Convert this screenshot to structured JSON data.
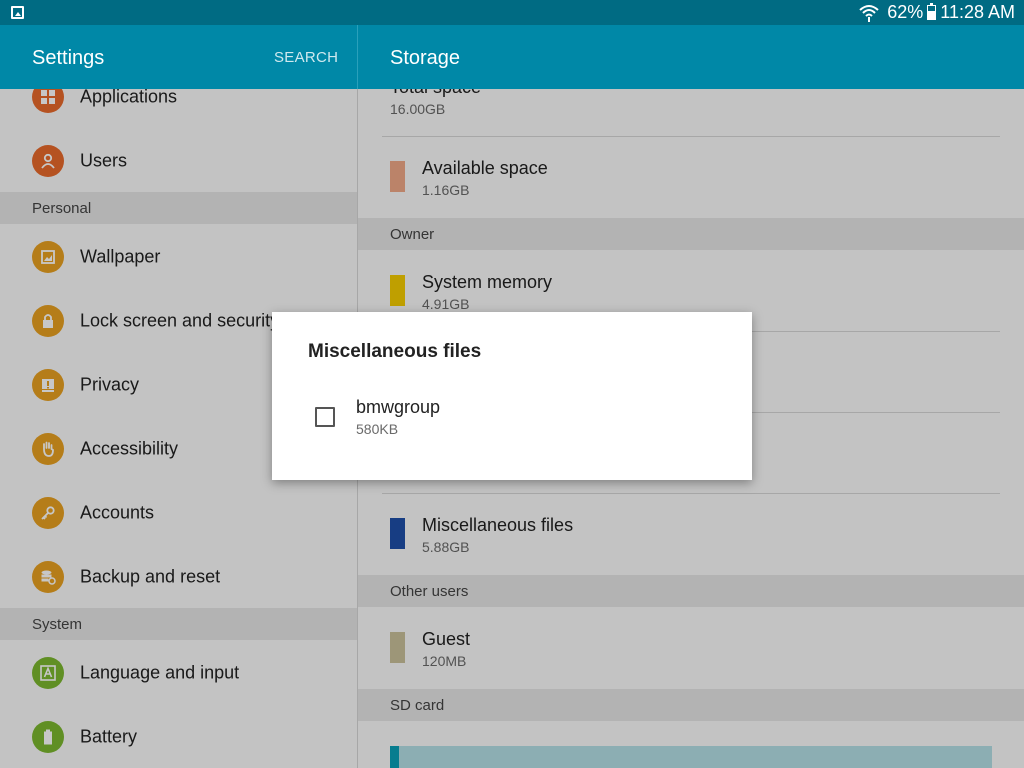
{
  "statusbar": {
    "battery_percent": "62%",
    "battery_level": 0.62,
    "time": "11:28 AM",
    "icons": [
      "image-icon",
      "wifi-icon",
      "battery-icon"
    ]
  },
  "appbar": {
    "left_title": "Settings",
    "search_label": "SEARCH",
    "right_title": "Storage",
    "color": "#0088a7"
  },
  "sidebar": {
    "items": [
      {
        "label": "Applications",
        "icon": "applications-icon",
        "color": "#e8692b"
      },
      {
        "label": "Users",
        "icon": "users-icon",
        "color": "#e8692b"
      },
      {
        "label": "Wallpaper",
        "icon": "wallpaper-icon",
        "color": "#e8a020"
      },
      {
        "label": "Lock screen and security",
        "icon": "lock-icon",
        "color": "#e8a020"
      },
      {
        "label": "Privacy",
        "icon": "privacy-icon",
        "color": "#e8a020"
      },
      {
        "label": "Accessibility",
        "icon": "accessibility-icon",
        "color": "#e8a020"
      },
      {
        "label": "Accounts",
        "icon": "key-icon",
        "color": "#e8a020"
      },
      {
        "label": "Backup and reset",
        "icon": "backup-icon",
        "color": "#e8a020"
      },
      {
        "label": "Language and input",
        "icon": "language-icon",
        "color": "#7cb82f"
      },
      {
        "label": "Battery",
        "icon": "battery-icon",
        "color": "#7cb82f"
      }
    ],
    "headers": {
      "personal": "Personal",
      "system": "System"
    }
  },
  "storage": {
    "total": {
      "title": "Total space",
      "value": "16.00GB"
    },
    "available": {
      "title": "Available space",
      "value": "1.16GB",
      "color": "#f0a887"
    },
    "owner_header": "Owner",
    "system_memory": {
      "title": "System memory",
      "value": "4.91GB",
      "color": "#f5cc00"
    },
    "misc": {
      "title": "Miscellaneous files",
      "value": "5.88GB",
      "color": "#1e4fa8"
    },
    "other_users_header": "Other users",
    "guest": {
      "title": "Guest",
      "value": "120MB",
      "color": "#c9c19a"
    },
    "sd_header": "SD card",
    "sd_used_fraction": 0.015
  },
  "dialog": {
    "title": "Miscellaneous files",
    "item_name": "bmwgroup",
    "item_size": "580KB",
    "checked": false
  }
}
